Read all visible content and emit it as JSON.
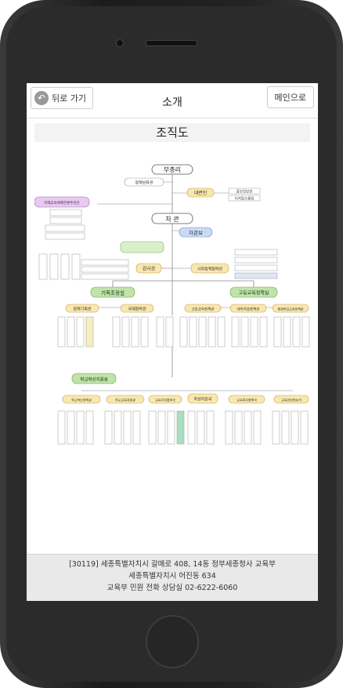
{
  "header": {
    "back_label": "뒤로 가기",
    "title": "소개",
    "main_label": "메인으로"
  },
  "section_title": "조직도",
  "org": {
    "minister": "부총리",
    "policy_advisor": "정책보좌관",
    "spokesperson": "대변인",
    "pr_officer": "홍보담당관",
    "digital_comm": "디지털소통팀",
    "future_edu_council": "미래교육체제전환추진단",
    "vice_minister": "차 관",
    "deputy": "차관보",
    "auditor": "감사관",
    "social_coop": "사회정책협력관",
    "planning": "기획조정실",
    "higher_edu": "고등교육정책실",
    "policy_planning": "정책기획관",
    "intl_coop": "국제협력관",
    "higher_policy": "고등교육정책관",
    "university_support": "대학학술정책관",
    "lifelong": "평생직업교육정책관",
    "school_innovation": "학교혁신지원실",
    "school_innov_policy": "학교혁신정책관",
    "school_edu_support": "학교교육지원관",
    "edu_autonomy": "교육자치협력국",
    "student_support": "학생지원국",
    "edu_welfare": "교육복지정책국",
    "safety": "교육안전정보국"
  },
  "footer": {
    "address": "[30119] 세종특별자치시 갈매로 408, 14동 정부세종청사 교육부",
    "address2": "세종특별자치시 어진동 634",
    "contact": "교육부 민원 전화 상담실 02-6222-6060"
  }
}
